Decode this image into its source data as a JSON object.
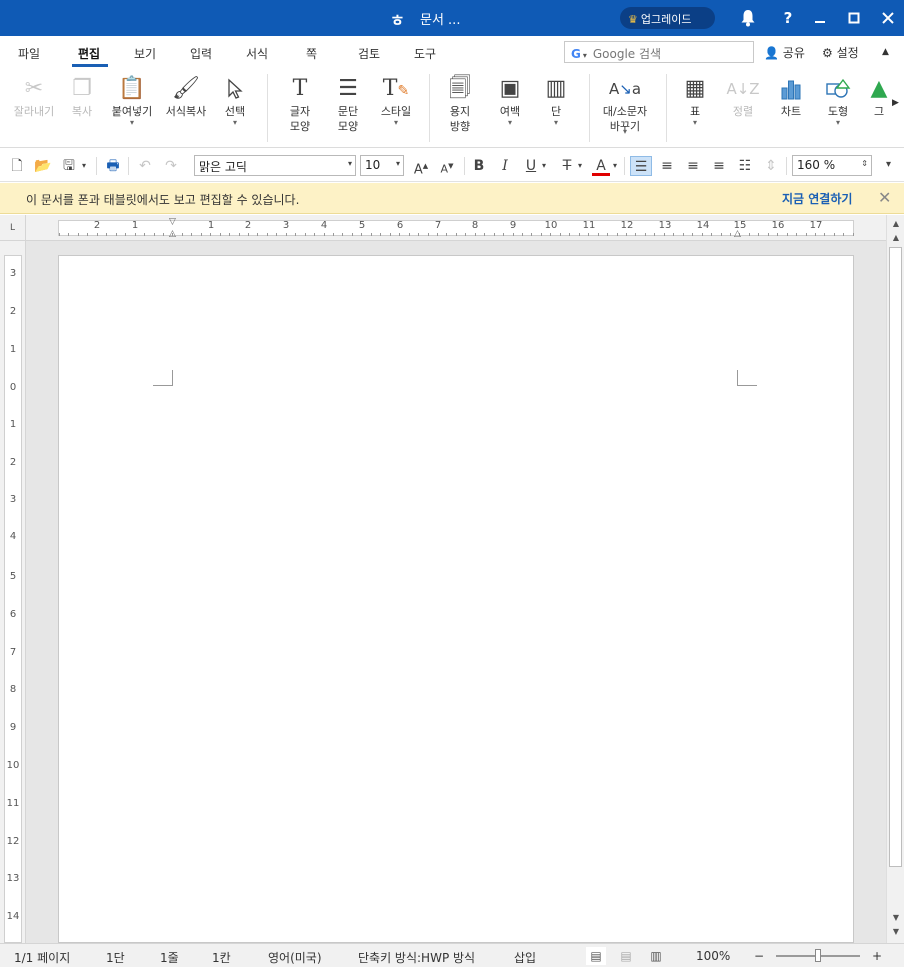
{
  "titlebar": {
    "app_logo": "ㅎ",
    "doc_title": "문서 ...",
    "upgrade_label": "업그레이드",
    "icons": [
      "crown-icon",
      "bell-icon",
      "help-icon",
      "minimize-icon",
      "maximize-icon",
      "close-icon"
    ]
  },
  "menu": {
    "items": [
      "파일",
      "편집",
      "보기",
      "입력",
      "서식",
      "쪽",
      "검토",
      "도구"
    ],
    "active": "편집",
    "search_placeholder": "Google 검색",
    "share_label": "공유",
    "settings_label": "설정"
  },
  "ribbon": {
    "cut": "잘라내기",
    "copy": "복사",
    "paste": "붙여넣기",
    "format_copy": "서식복사",
    "select": "선택",
    "char_shape_1": "글자",
    "char_shape_2": "모양",
    "para_shape_1": "문단",
    "para_shape_2": "모양",
    "style": "스타일",
    "orientation_1": "용지",
    "orientation_2": "방향",
    "margin": "여백",
    "columns": "단",
    "case_1": "대/소문자",
    "case_2": "바꾸기",
    "table": "표",
    "sort": "정렬",
    "chart": "차트",
    "shape": "도형",
    "picture": "그"
  },
  "format_toolbar": {
    "font_name": "맑은 고딕",
    "font_size": "10",
    "zoom": "160 %",
    "accent_color": "#1a5fb4",
    "font_color": "#e00000"
  },
  "notice": {
    "message": "이 문서를 폰과 태블릿에서도 보고 편집할 수 있습니다.",
    "connect_label": "지금 연결하기",
    "background": "#fdf2c6"
  },
  "ruler": {
    "corner": "L",
    "h_labels": [
      "2",
      "1",
      "1",
      "2",
      "3",
      "4",
      "5",
      "6",
      "7",
      "8",
      "9",
      "10",
      "11",
      "12",
      "13",
      "14",
      "15",
      "16",
      "17"
    ],
    "v_labels": [
      "3",
      "2",
      "1",
      "0",
      "1",
      "2",
      "3",
      "4",
      "5",
      "6",
      "7",
      "8",
      "9",
      "10",
      "11",
      "12",
      "13",
      "14"
    ]
  },
  "statusbar": {
    "page": "1/1 페이지",
    "column": "1단",
    "line": "1줄",
    "char_col": "1칸",
    "language": "영어(미국)",
    "shortcut_mode": "단축키 방식:HWP 방식",
    "insert_mode": "삽입",
    "zoom": "100%",
    "zoom_out": "−",
    "zoom_in": "+"
  }
}
